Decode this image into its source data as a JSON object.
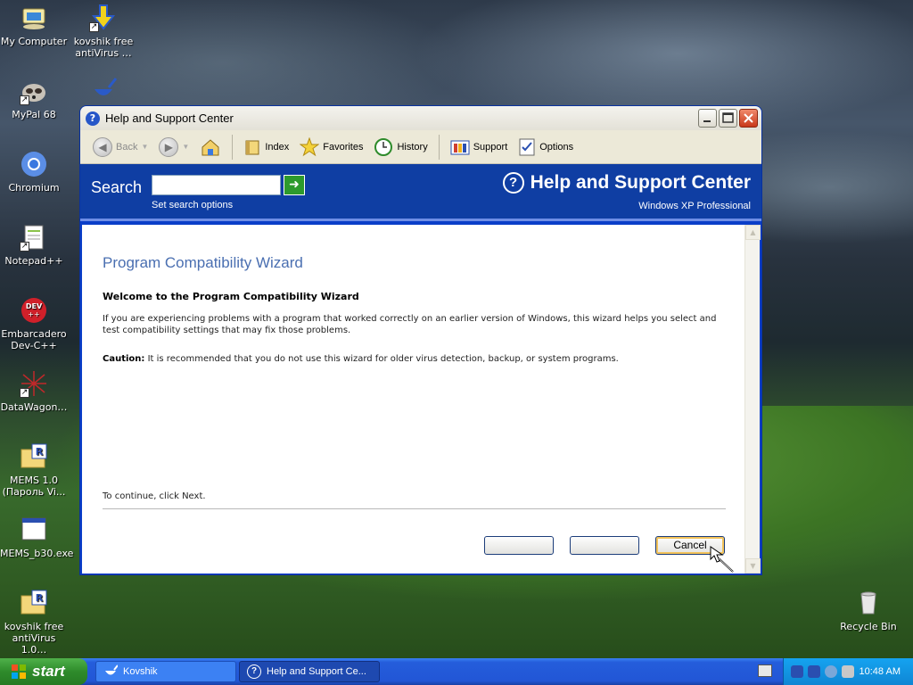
{
  "desktop": {
    "icons": [
      {
        "label": "My Computer"
      },
      {
        "label": "kovshik free\nantiVirus …"
      },
      {
        "label": "MyPal 68"
      },
      {
        "label": ""
      },
      {
        "label": "Chromium"
      },
      {
        "label": "Notepad++"
      },
      {
        "label": "Embarcadero\nDev-C++"
      },
      {
        "label": "DataWagon…"
      },
      {
        "label": "MEMS 1.0\n(Пароль Vi..."
      },
      {
        "label": "MEMS_b30.exe"
      },
      {
        "label": "kovshik free\nantiVirus 1.0…"
      },
      {
        "label": "Recycle Bin"
      }
    ]
  },
  "window": {
    "title": "Help and Support Center",
    "toolbar": {
      "back": "Back",
      "index": "Index",
      "favorites": "Favorites",
      "history": "History",
      "support": "Support",
      "options": "Options"
    },
    "banner": {
      "search_label": "Search",
      "search_value": "",
      "set_options": "Set search options",
      "product_title": "Help and Support Center",
      "edition": "Windows XP Professional"
    },
    "wizard": {
      "title": "Program Compatibility Wizard",
      "welcome": "Welcome to the Program Compatibility Wizard",
      "description": "If you are experiencing problems with a program that worked correctly on an earlier version of Windows, this wizard helps you select and test compatibility settings that may fix those problems.",
      "caution_label": "Caution:",
      "caution_text": "It is recommended that you do not use this wizard for older virus detection, backup, or system programs.",
      "continue_text": "To continue, click Next.",
      "buttons": {
        "back": "",
        "next": "",
        "cancel": "Cancel"
      }
    }
  },
  "taskbar": {
    "start": "start",
    "tasks": [
      {
        "label": "Kovshik"
      },
      {
        "label": "Help and Support Ce..."
      }
    ],
    "clock": "10:48 AM"
  },
  "colors": {
    "banner_blue": "#0f3ea3",
    "wizard_title": "#4a6fb1",
    "taskbar_blue": "#245ddb",
    "start_green": "#2e8b2b"
  }
}
